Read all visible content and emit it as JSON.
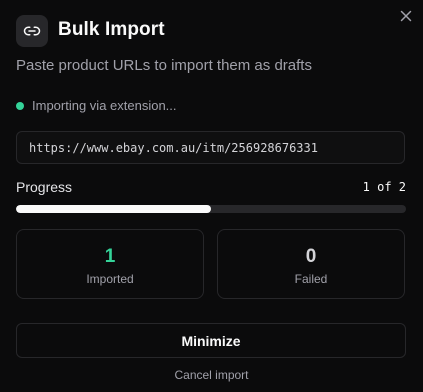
{
  "dialog": {
    "title": "Bulk Import",
    "subtitle": "Paste product URLs to import them as drafts",
    "header_icon": "link-icon",
    "close_icon": "close-icon"
  },
  "status": {
    "text": "Importing via extension...",
    "dot_color": "#34d399"
  },
  "url_field": {
    "value": "https://www.ebay.com.au/itm/256928676331"
  },
  "progress": {
    "label": "Progress",
    "count_text": "1 of 2",
    "current": 1,
    "total": 2,
    "fraction": 0.5
  },
  "stats": {
    "imported": {
      "value": "1",
      "label": "Imported",
      "color": "#34d399"
    },
    "failed": {
      "value": "0",
      "label": "Failed",
      "color": "#d4d4d8"
    }
  },
  "actions": {
    "minimize_label": "Minimize",
    "cancel_label": "Cancel import"
  }
}
